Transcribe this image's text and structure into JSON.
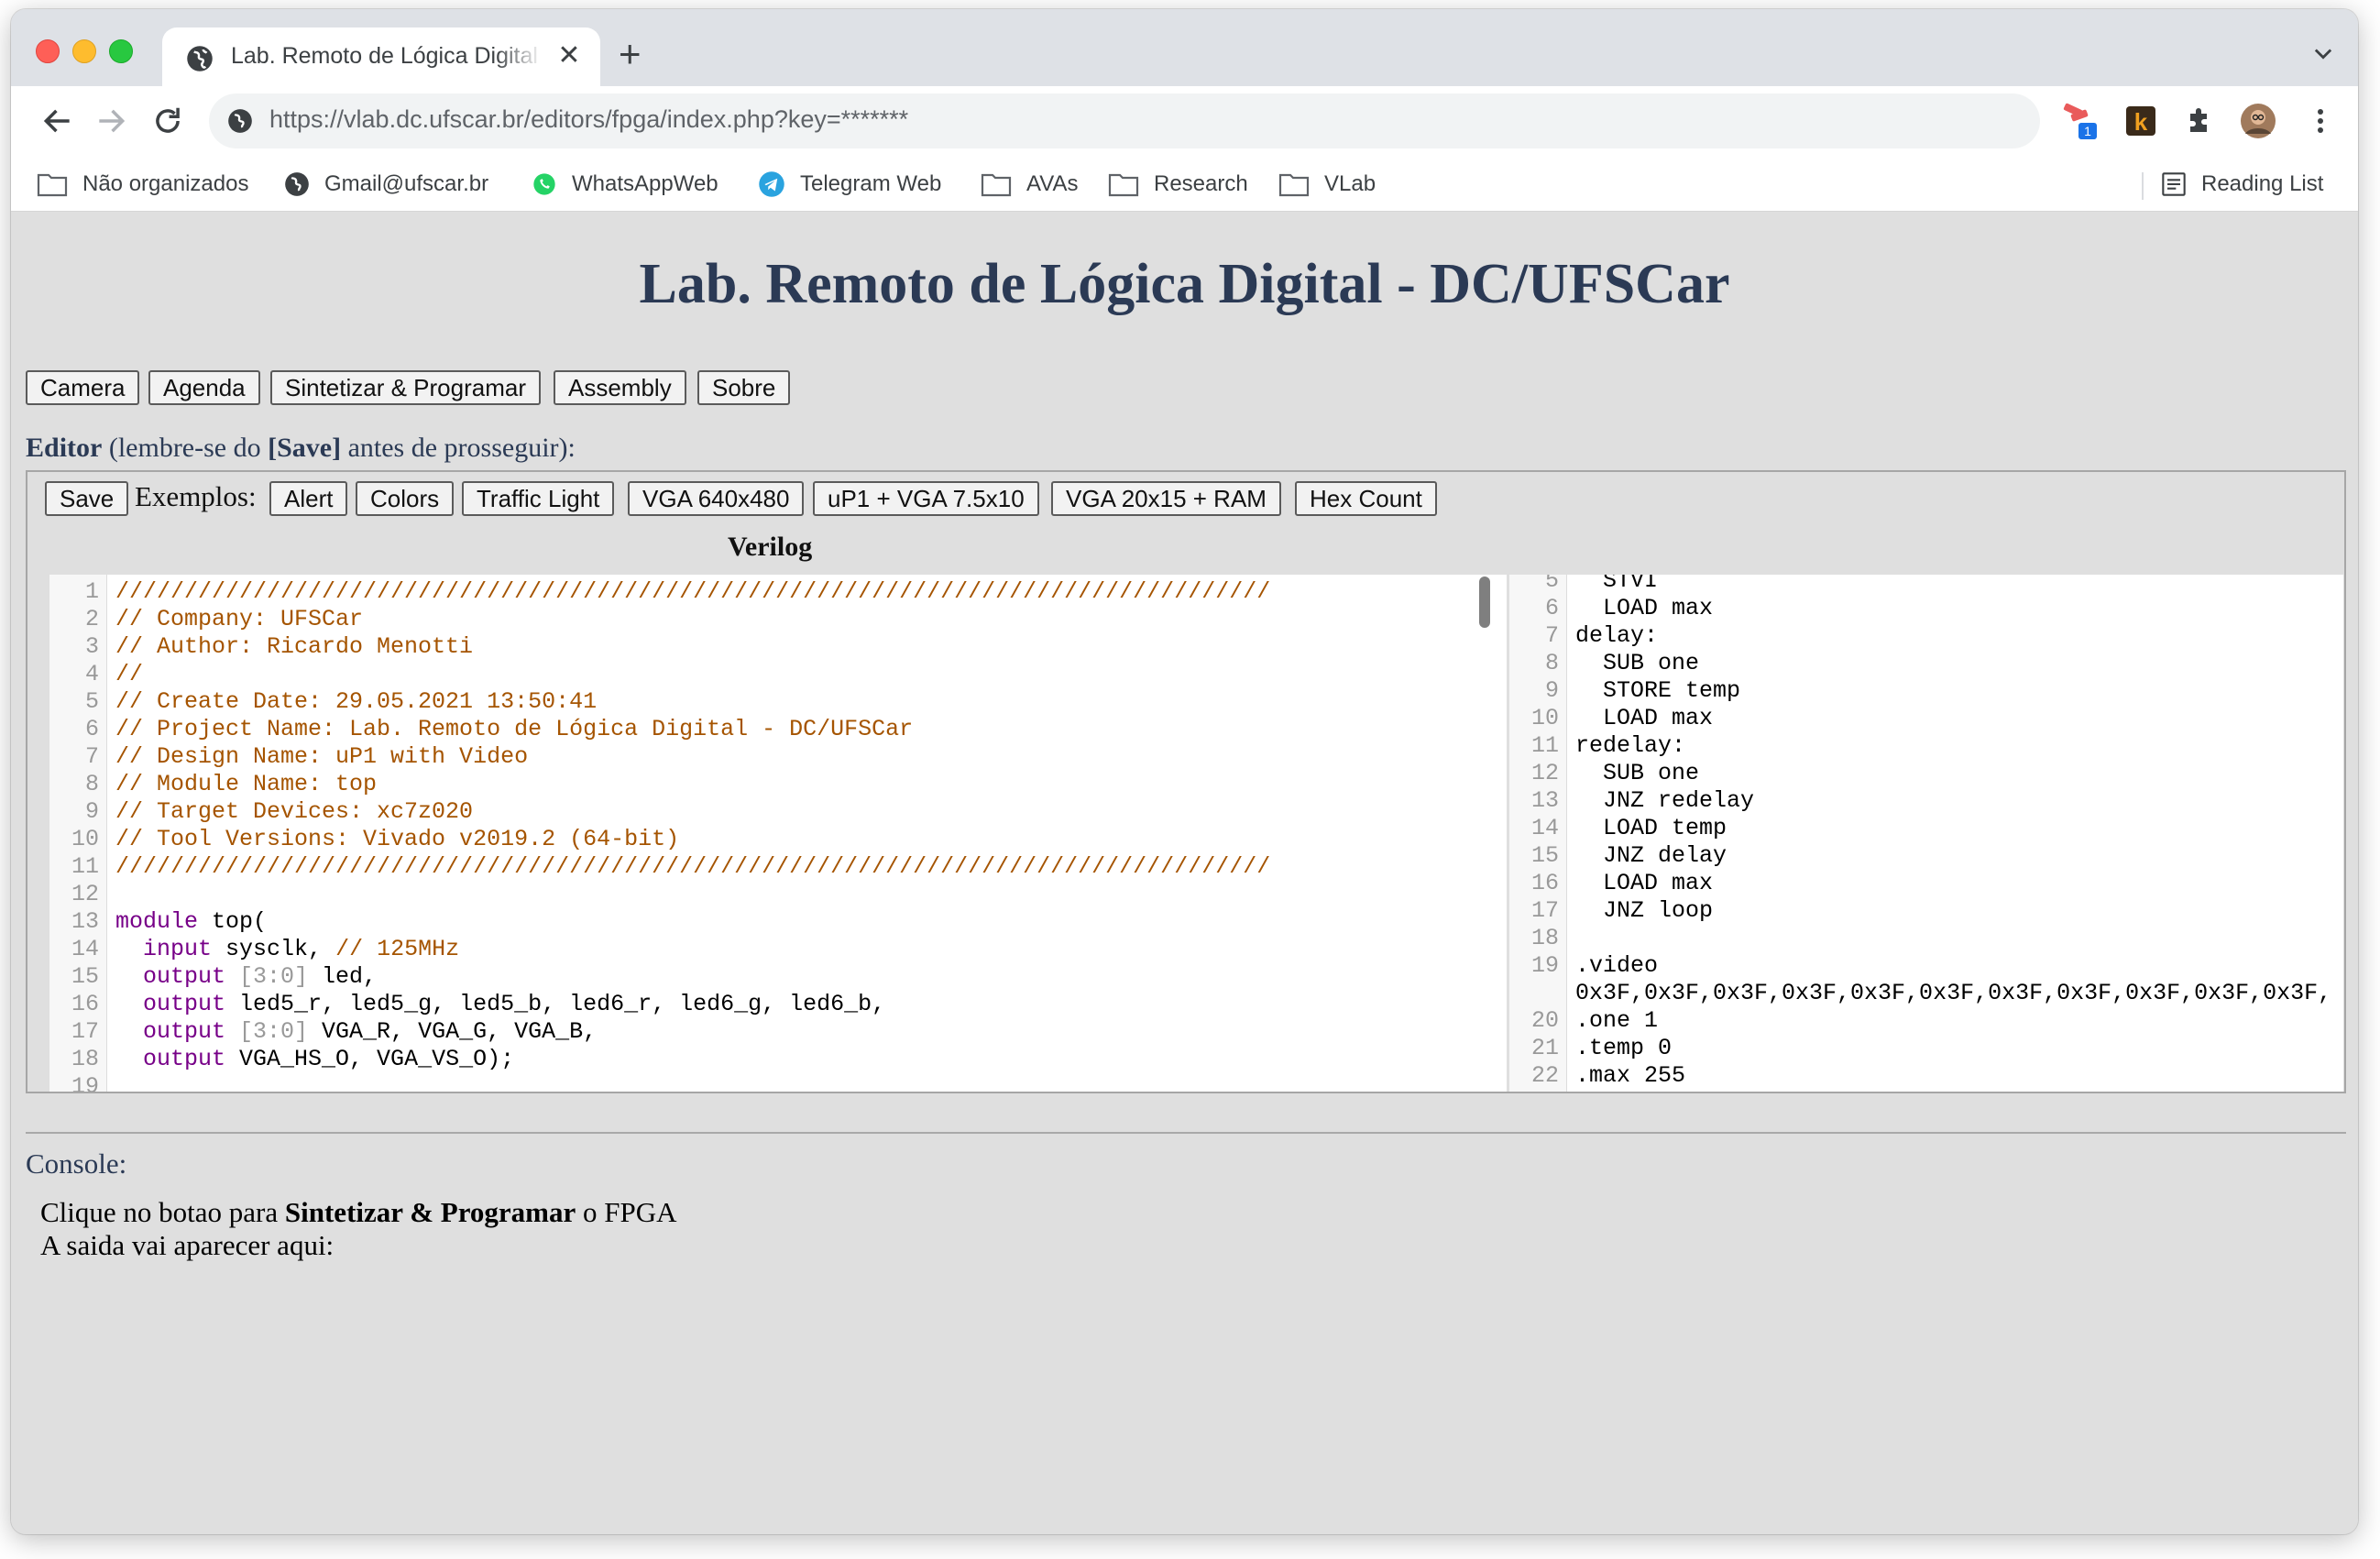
{
  "browser": {
    "tab_title": "Lab. Remoto de Lógica Digital - DC/UFSCar",
    "url_host": "https://vlab.dc.ufscar.br",
    "url_path": "/editors/fpga/index.php?key=*******",
    "extension_badge": "1",
    "bookmarks": [
      {
        "label": "Não organizados",
        "icon": "folder-icon"
      },
      {
        "label": "Gmail@ufscar.br",
        "icon": "globe-icon"
      },
      {
        "label": "WhatsAppWeb",
        "icon": "whatsapp-icon"
      },
      {
        "label": "Telegram Web",
        "icon": "telegram-icon"
      },
      {
        "label": "AVAs",
        "icon": "folder-icon"
      },
      {
        "label": "Research",
        "icon": "folder-icon"
      },
      {
        "label": "VLab",
        "icon": "folder-icon"
      }
    ],
    "reading_list": "Reading List"
  },
  "page": {
    "title": "Lab. Remoto de Lógica Digital - DC/UFSCar",
    "nav_buttons": [
      "Camera",
      "Agenda",
      "Sintetizar & Programar",
      "Assembly",
      "Sobre"
    ],
    "editor_label_bold": "Editor",
    "editor_label_pre": "(lembre-se do",
    "editor_label_save": "[Save]",
    "editor_label_post": "antes de prosseguir):",
    "save_button": "Save",
    "exemplos_label": "Exemplos:",
    "example_buttons": [
      "Alert",
      "Colors",
      "Traffic Light",
      "VGA 640x480",
      "uP1 + VGA 7.5x10",
      "VGA 20x15 + RAM",
      "Hex Count"
    ],
    "verilog_label": "Verilog",
    "console_label": "Console:",
    "console_line1_pre": "Clique no botao para",
    "console_line1_bold": "Sintetizar & Programar",
    "console_line1_post": "o FPGA",
    "console_line2": "A saida vai aparecer aqui:"
  },
  "verilog_code": [
    {
      "n": "1",
      "text": "////////////////////////////////////////////////////////////////////////////////////",
      "type": "comment"
    },
    {
      "n": "2",
      "text": "// Company: UFSCar",
      "type": "comment"
    },
    {
      "n": "3",
      "text": "// Author: Ricardo Menotti",
      "type": "comment"
    },
    {
      "n": "4",
      "text": "//",
      "type": "comment"
    },
    {
      "n": "5",
      "text": "// Create Date: 29.05.2021 13:50:41",
      "type": "comment"
    },
    {
      "n": "6",
      "text": "// Project Name: Lab. Remoto de Lógica Digital - DC/UFSCar",
      "type": "comment"
    },
    {
      "n": "7",
      "text": "// Design Name: uP1 with Video",
      "type": "comment"
    },
    {
      "n": "8",
      "text": "// Module Name: top",
      "type": "comment"
    },
    {
      "n": "9",
      "text": "// Target Devices: xc7z020",
      "type": "comment"
    },
    {
      "n": "10",
      "text": "// Tool Versions: Vivado v2019.2 (64-bit)",
      "type": "comment"
    },
    {
      "n": "11",
      "text": "////////////////////////////////////////////////////////////////////////////////////",
      "type": "comment"
    },
    {
      "n": "12",
      "text": "",
      "type": "plain"
    },
    {
      "n": "13",
      "kw": "module",
      "rest": " top(",
      "type": "kw"
    },
    {
      "n": "14",
      "indent": "  ",
      "kw": "input",
      "rest": " sysclk, ",
      "comment": "// 125MHz",
      "type": "kw"
    },
    {
      "n": "15",
      "indent": "  ",
      "kw": "output",
      "range": " [3:0]",
      "rest": " led,",
      "type": "kw"
    },
    {
      "n": "16",
      "indent": "  ",
      "kw": "output",
      "rest": " led5_r, led5_g, led5_b, led6_r, led6_g, led6_b,",
      "type": "kw"
    },
    {
      "n": "17",
      "indent": "  ",
      "kw": "output",
      "range": " [3:0]",
      "rest": " VGA_R, VGA_G, VGA_B,",
      "type": "kw"
    },
    {
      "n": "18",
      "indent": "  ",
      "kw": "output",
      "rest": " VGA_HS_O, VGA_VS_O);",
      "type": "kw"
    },
    {
      "n": "19",
      "text": "",
      "type": "plain"
    }
  ],
  "assembly_code": [
    {
      "n": "5",
      "text": "  STVI"
    },
    {
      "n": "6",
      "text": "  LOAD max"
    },
    {
      "n": "7",
      "text": "delay:"
    },
    {
      "n": "8",
      "text": "  SUB one"
    },
    {
      "n": "9",
      "text": "  STORE temp"
    },
    {
      "n": "10",
      "text": "  LOAD max"
    },
    {
      "n": "11",
      "text": "redelay:"
    },
    {
      "n": "12",
      "text": "  SUB one"
    },
    {
      "n": "13",
      "text": "  JNZ redelay"
    },
    {
      "n": "14",
      "text": "  LOAD temp"
    },
    {
      "n": "15",
      "text": "  JNZ delay"
    },
    {
      "n": "16",
      "text": "  LOAD max"
    },
    {
      "n": "17",
      "text": "  JNZ loop"
    },
    {
      "n": "18",
      "text": ""
    },
    {
      "n": "19",
      "text": ".video"
    },
    {
      "n": "",
      "text": "0x3F,0x3F,0x3F,0x3F,0x3F,0x3F,0x3F,0x3F,0x3F,0x3F,0x3F,"
    },
    {
      "n": "20",
      "text": ".one 1"
    },
    {
      "n": "21",
      "text": ".temp 0"
    },
    {
      "n": "22",
      "text": ".max 255"
    }
  ]
}
